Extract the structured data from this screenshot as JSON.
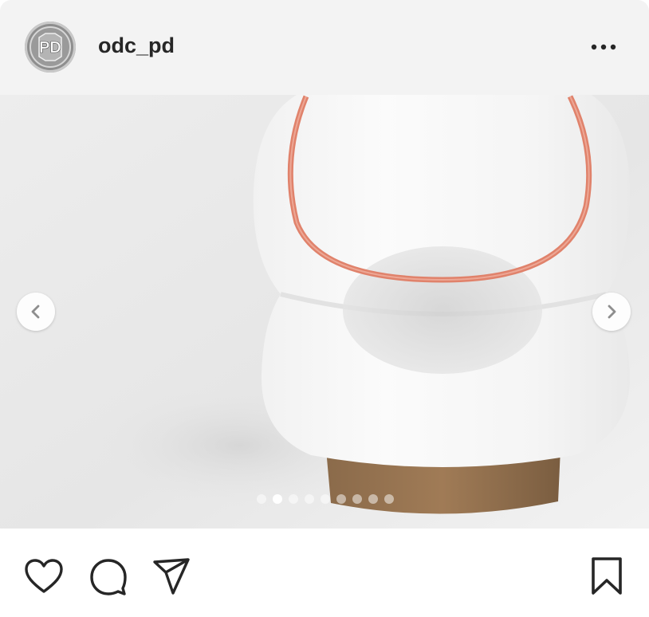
{
  "post": {
    "username": "odc_pd",
    "avatar_text": "PD",
    "more_icon": "more-horizontal-icon"
  },
  "media": {
    "description_icon_prev": "chevron-left-icon",
    "description_icon_next": "chevron-right-icon",
    "slide_count": 9,
    "active_slide": 2
  },
  "actions": {
    "icons": [
      "heart-icon",
      "comment-icon",
      "share-icon",
      "bookmark-icon"
    ]
  },
  "colors": {
    "header_bg": "#f3f3f3",
    "text": "#262626",
    "rim": "#e0826b"
  }
}
